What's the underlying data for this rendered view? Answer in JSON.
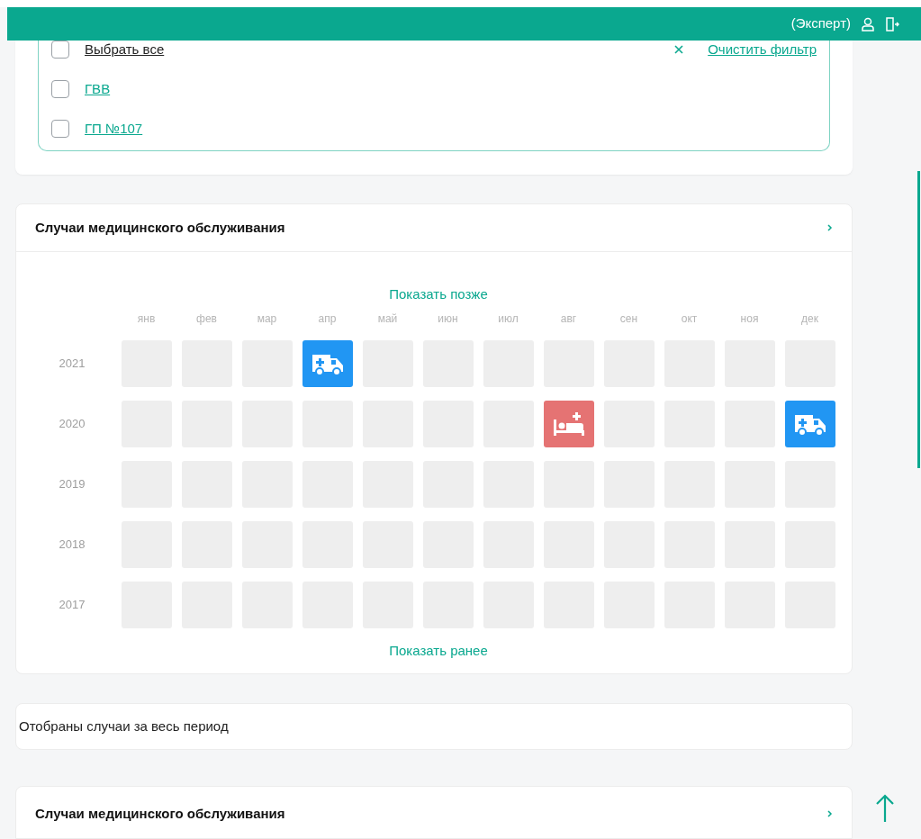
{
  "header": {
    "role": "(Эксперт)"
  },
  "filter": {
    "select_all": {
      "label": "Выбрать все",
      "checked": false
    },
    "clear": {
      "label": "Очистить фильтр"
    },
    "items": [
      {
        "label": "ГВВ",
        "checked": false
      },
      {
        "label": "ГП №107",
        "checked": false
      }
    ]
  },
  "calendar": {
    "title": "Случаи медицинского обслуживания",
    "show_later": "Показать позже",
    "show_earlier": "Показать ранее",
    "months": [
      "янв",
      "фев",
      "мар",
      "апр",
      "май",
      "июн",
      "июл",
      "авг",
      "сен",
      "окт",
      "ноя",
      "дек"
    ],
    "years": [
      {
        "year": "2021",
        "cells": [
          {
            "kind": "empty"
          },
          {
            "kind": "empty"
          },
          {
            "kind": "empty"
          },
          {
            "kind": "ambulance"
          },
          {
            "kind": "empty"
          },
          {
            "kind": "empty"
          },
          {
            "kind": "empty"
          },
          {
            "kind": "empty"
          },
          {
            "kind": "empty"
          },
          {
            "kind": "empty"
          },
          {
            "kind": "empty"
          },
          {
            "kind": "empty"
          }
        ]
      },
      {
        "year": "2020",
        "cells": [
          {
            "kind": "empty"
          },
          {
            "kind": "empty"
          },
          {
            "kind": "empty"
          },
          {
            "kind": "empty"
          },
          {
            "kind": "empty"
          },
          {
            "kind": "empty"
          },
          {
            "kind": "empty"
          },
          {
            "kind": "hospital"
          },
          {
            "kind": "empty"
          },
          {
            "kind": "empty"
          },
          {
            "kind": "empty"
          },
          {
            "kind": "ambulance"
          }
        ]
      },
      {
        "year": "2019",
        "cells": [
          {
            "kind": "empty"
          },
          {
            "kind": "empty"
          },
          {
            "kind": "empty"
          },
          {
            "kind": "empty"
          },
          {
            "kind": "empty"
          },
          {
            "kind": "empty"
          },
          {
            "kind": "empty"
          },
          {
            "kind": "empty"
          },
          {
            "kind": "empty"
          },
          {
            "kind": "empty"
          },
          {
            "kind": "empty"
          },
          {
            "kind": "empty"
          }
        ]
      },
      {
        "year": "2018",
        "cells": [
          {
            "kind": "empty"
          },
          {
            "kind": "empty"
          },
          {
            "kind": "empty"
          },
          {
            "kind": "empty"
          },
          {
            "kind": "empty"
          },
          {
            "kind": "empty"
          },
          {
            "kind": "empty"
          },
          {
            "kind": "empty"
          },
          {
            "kind": "empty"
          },
          {
            "kind": "empty"
          },
          {
            "kind": "empty"
          },
          {
            "kind": "empty"
          }
        ]
      },
      {
        "year": "2017",
        "cells": [
          {
            "kind": "empty"
          },
          {
            "kind": "empty"
          },
          {
            "kind": "empty"
          },
          {
            "kind": "empty"
          },
          {
            "kind": "empty"
          },
          {
            "kind": "empty"
          },
          {
            "kind": "empty"
          },
          {
            "kind": "empty"
          },
          {
            "kind": "empty"
          },
          {
            "kind": "empty"
          },
          {
            "kind": "empty"
          },
          {
            "kind": "empty"
          }
        ]
      }
    ]
  },
  "period_note": "Отобраны случаи за весь период",
  "second_section": {
    "title": "Случаи медицинского обслуживания"
  }
}
